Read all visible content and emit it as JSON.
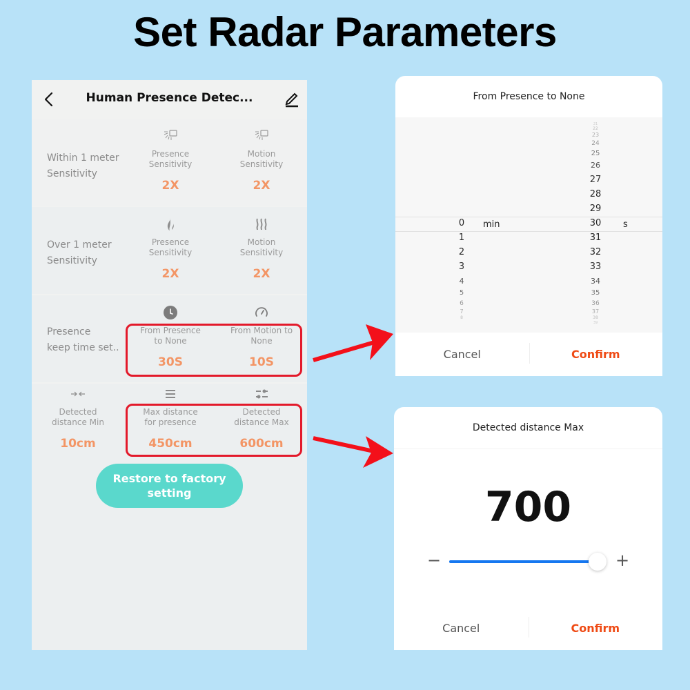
{
  "banner": {
    "title": "Set Radar Parameters"
  },
  "phone": {
    "title": "Human Presence Detec...",
    "icons": {
      "back": "chevron-left-icon",
      "edit": "pencil-icon"
    },
    "sections": [
      {
        "label": "Within 1 meter\nSensitivity",
        "cells": [
          {
            "icon": "radar-lamp-icon",
            "label": "Presence\nSensitivity",
            "value": "2X"
          },
          {
            "icon": "radar-lamp-icon",
            "label": "Motion\nSensitivity",
            "value": "2X"
          }
        ]
      },
      {
        "label": "Over 1 meter\nSensitivity",
        "cells": [
          {
            "icon": "flame-icon",
            "label": "Presence\nSensitivity",
            "value": "2X"
          },
          {
            "icon": "heat-waves-icon",
            "label": "Motion\nSensitivity",
            "value": "2X"
          }
        ]
      },
      {
        "label": "Presence\nkeep time set..",
        "cells": [
          {
            "icon": "clock-icon",
            "label": "From Presence\nto None",
            "value": "30S"
          },
          {
            "icon": "gauge-icon",
            "label": "From Motion to\nNone",
            "value": "10S"
          }
        ]
      },
      {
        "label": "",
        "cells": [
          {
            "icon": "arrows-inward-icon",
            "label": "Detected\ndistance Min",
            "value": "10cm"
          },
          {
            "icon": "menu-lines-icon",
            "label": "Max distance\nfor presence",
            "value": "450cm"
          },
          {
            "icon": "sliders-icon",
            "label": "Detected\ndistance Max",
            "value": "600cm"
          }
        ]
      }
    ],
    "restore_button": "Restore to factory\nsetting"
  },
  "time_dialog": {
    "title": "From Presence to None",
    "minutes": {
      "selected": "0",
      "unit": "min",
      "items": [
        "0",
        "1",
        "2",
        "3",
        "4",
        "5",
        "6",
        "7",
        "8"
      ]
    },
    "seconds": {
      "selected": "30",
      "unit": "s",
      "above": [
        "21",
        "22",
        "23",
        "24",
        "25",
        "26",
        "27",
        "28",
        "29"
      ],
      "below": [
        "31",
        "32",
        "33",
        "34",
        "35",
        "36",
        "37",
        "38",
        "39"
      ]
    },
    "cancel": "Cancel",
    "confirm": "Confirm"
  },
  "distance_dialog": {
    "title": "Detected distance Max",
    "value": "700",
    "slider_fraction": 1.0,
    "minus": "−",
    "plus": "+",
    "cancel": "Cancel",
    "confirm": "Confirm"
  },
  "colors": {
    "accent_orange": "#f39565",
    "confirm": "#ef4a14",
    "restore_btn": "#5ad8cc",
    "slider": "#1677f0",
    "highlight": "#e3192a",
    "background": "#b8e2f8"
  }
}
